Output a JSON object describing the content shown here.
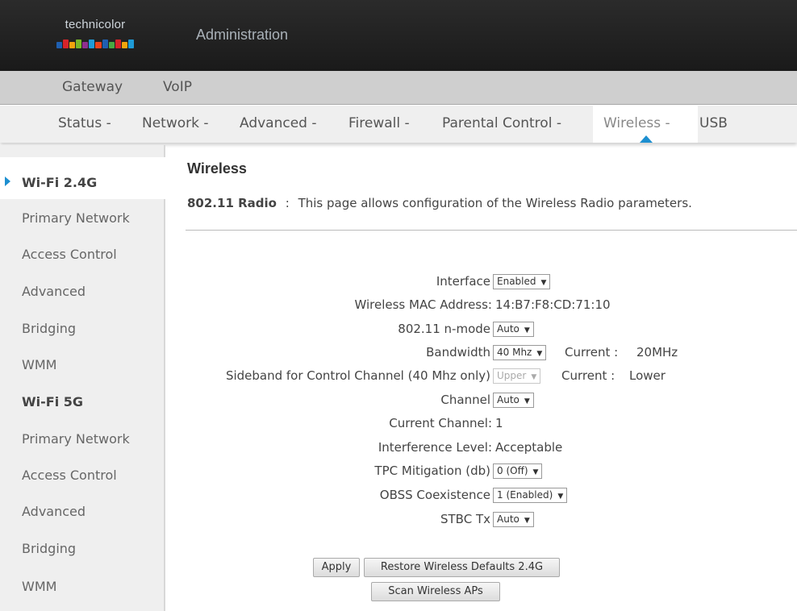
{
  "header": {
    "logo_text": "technicolor",
    "title": "Administration",
    "logo_colors": [
      "#1f5fb0",
      "#d6232a",
      "#f2a40c",
      "#7ab929",
      "#8f2f8f",
      "#1e9bd7",
      "#e8431b",
      "#1f5fb0",
      "#49a942",
      "#d6232a",
      "#f2a40c",
      "#1e9bd7"
    ]
  },
  "topnav": [
    "Gateway",
    "VoIP"
  ],
  "menu": [
    {
      "label": "Status -"
    },
    {
      "label": "Network -"
    },
    {
      "label": "Advanced -"
    },
    {
      "label": "Firewall -"
    },
    {
      "label": "Parental Control -"
    },
    {
      "label": "Wireless -",
      "active": true
    },
    {
      "label": "USB"
    }
  ],
  "sidebar": [
    {
      "label": "Wi-Fi 2.4G",
      "section": true,
      "current": true
    },
    {
      "label": "Primary Network"
    },
    {
      "label": "Access Control"
    },
    {
      "label": "Advanced"
    },
    {
      "label": "Bridging"
    },
    {
      "label": "WMM"
    },
    {
      "label": "Wi-Fi 5G",
      "section": true
    },
    {
      "label": "Primary Network"
    },
    {
      "label": "Access Control"
    },
    {
      "label": "Advanced"
    },
    {
      "label": "Bridging"
    },
    {
      "label": "WMM"
    }
  ],
  "main": {
    "title": "Wireless",
    "desc_bold": "802.11 Radio",
    "desc_sep": ":",
    "desc_text": "This page allows configuration of the Wireless Radio parameters."
  },
  "form": {
    "interface": {
      "label": "Interface",
      "value": "Enabled"
    },
    "mac": {
      "label": "Wireless MAC Address:",
      "value": "14:B7:F8:CD:71:10"
    },
    "nmode": {
      "label": "802.11 n-mode",
      "value": "Auto"
    },
    "bandwidth": {
      "label": "Bandwidth",
      "value": "40 Mhz",
      "current_label": "Current :",
      "current_value": "20MHz"
    },
    "sideband": {
      "label": "Sideband for Control Channel (40 Mhz only)",
      "value": "Upper",
      "current_label": "Current :",
      "current_value": "Lower"
    },
    "channel": {
      "label": "Channel",
      "value": "Auto"
    },
    "current_channel": {
      "label": "Current Channel:",
      "value": "1"
    },
    "interference": {
      "label": "Interference Level:",
      "value": "Acceptable"
    },
    "tpc": {
      "label": "TPC Mitigation (db)",
      "value": "0 (Off)"
    },
    "obss": {
      "label": "OBSS Coexistence",
      "value": "1 (Enabled)"
    },
    "stbc": {
      "label": "STBC Tx",
      "value": "Auto"
    }
  },
  "buttons": {
    "apply": "Apply",
    "restore": "Restore Wireless Defaults 2.4G",
    "scan": "Scan Wireless APs"
  }
}
